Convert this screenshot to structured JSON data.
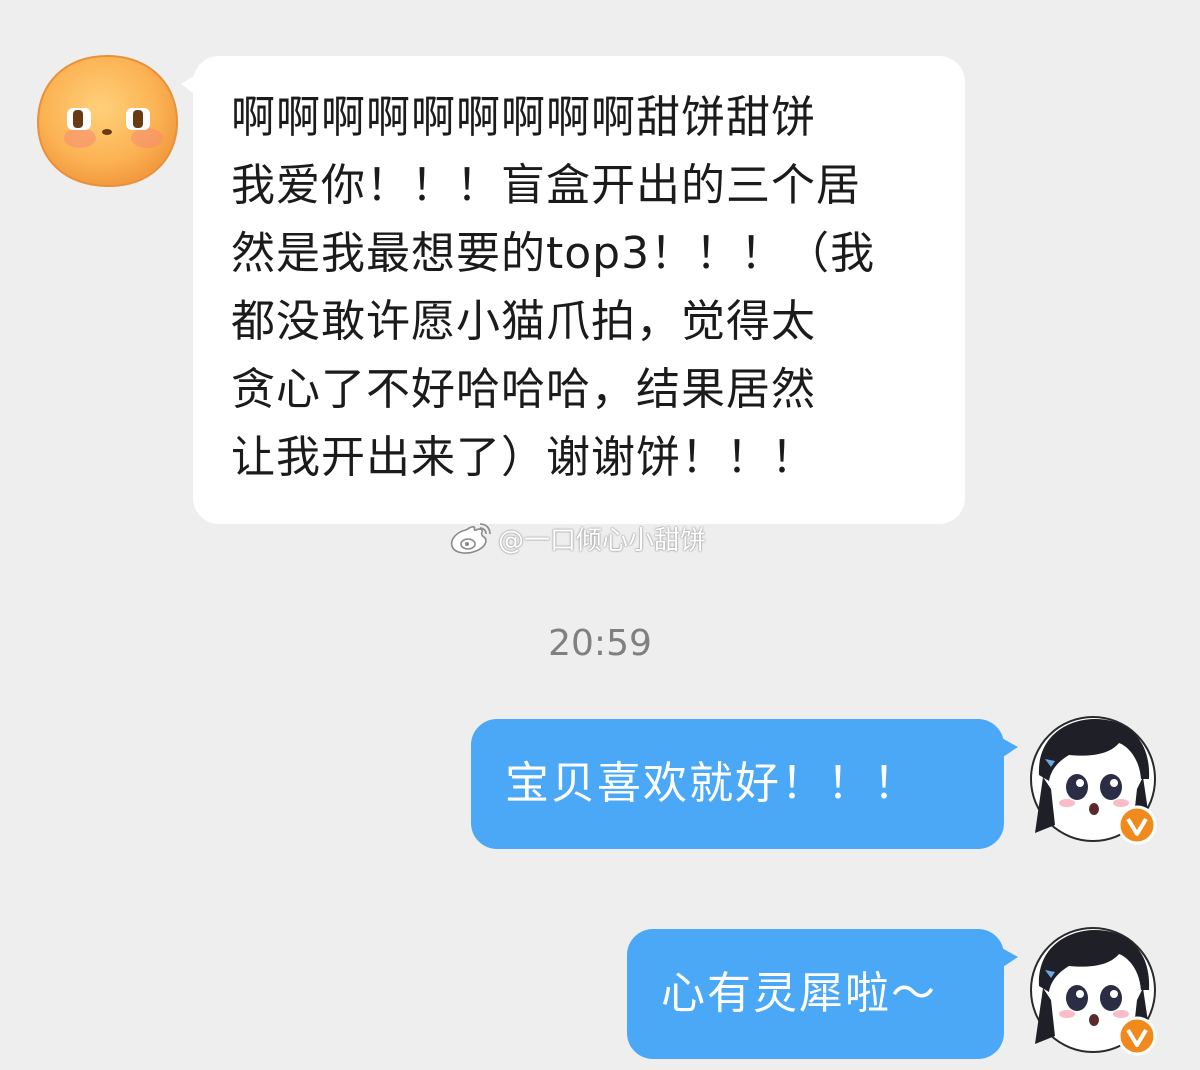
{
  "messages": {
    "incoming": {
      "lines": [
        "啊啊啊啊啊啊啊啊啊甜饼甜饼",
        "我爱你！！！盲盒开出的三个居",
        "然是我最想要的top3！！！（我",
        "都没敢许愿小猫爪拍，觉得太",
        "贪心了不好哈哈哈，结果居然",
        "让我开出来了）谢谢饼！！！"
      ],
      "avatar_icon": "orange-bun-face-avatar"
    },
    "watermark": {
      "text": "@一口倾心小甜饼",
      "icon": "weibo-logo-icon"
    },
    "timestamp": "20:59",
    "outgoing": [
      {
        "text": "宝贝喜欢就好！！！",
        "avatar_icon": "anime-girl-avatar",
        "badge_icon": "verified-v-badge-icon"
      },
      {
        "text": "心有灵犀啦～",
        "avatar_icon": "anime-girl-avatar",
        "badge_icon": "verified-v-badge-icon"
      }
    ]
  },
  "colors": {
    "background": "#eeeeee",
    "incoming_bubble": "#ffffff",
    "outgoing_bubble": "#4aa8f7",
    "timestamp_text": "#808080",
    "badge": "#f08a1c"
  }
}
